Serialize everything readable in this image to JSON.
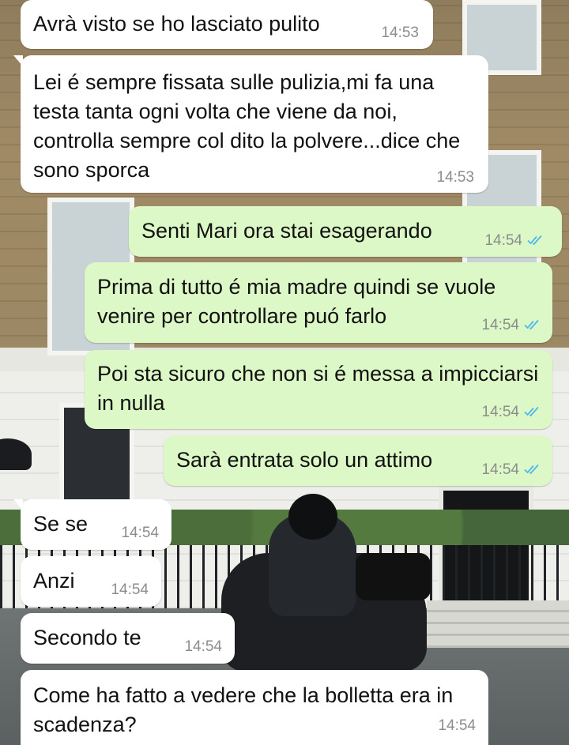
{
  "messages": [
    {
      "direction": "in",
      "text": "Avrà visto se ho lasciato pulito",
      "time": "14:53"
    },
    {
      "direction": "in",
      "text": "Lei é sempre fissata sulle pulizia,mi fa una testa tanta ogni volta che viene da noi, controlla sempre col dito la polvere...dice che sono sporca",
      "time": "14:53"
    },
    {
      "direction": "out",
      "text": "Senti Mari ora stai esagerando",
      "time": "14:54",
      "status": "read"
    },
    {
      "direction": "out",
      "text": "Prima di tutto é mia madre quindi se vuole venire per controllare puó farlo",
      "time": "14:54",
      "status": "read"
    },
    {
      "direction": "out",
      "text": "Poi sta sicuro che non si é messa a impicciarsi in nulla",
      "time": "14:54",
      "status": "read"
    },
    {
      "direction": "out",
      "text": "Sarà entrata solo un attimo",
      "time": "14:54",
      "status": "read"
    },
    {
      "direction": "in",
      "text": "Se se",
      "time": "14:54"
    },
    {
      "direction": "in",
      "text": "Anzi",
      "time": "14:54"
    },
    {
      "direction": "in",
      "text": "Secondo te",
      "time": "14:54"
    },
    {
      "direction": "in",
      "text": "Come ha fatto a vedere che la bolletta era in scadenza?",
      "time": "14:54"
    }
  ],
  "colors": {
    "incoming_bubble": "#ffffff",
    "outgoing_bubble": "#dcf8c6",
    "timestamp": "#8c8c8c",
    "read_ticks": "#4fb6ec"
  },
  "icons": {
    "read_receipt": "double-check-icon"
  }
}
